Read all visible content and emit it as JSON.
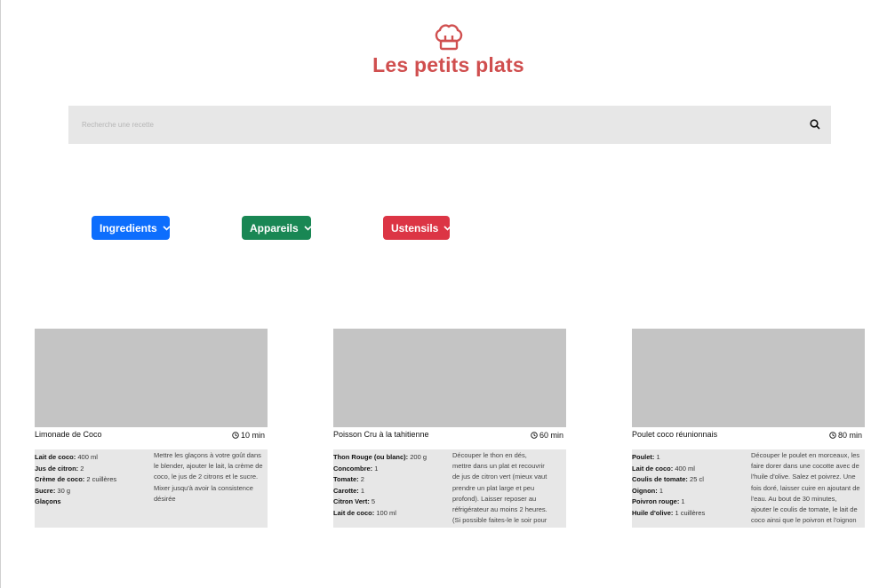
{
  "brand": {
    "name": "Les petits plats",
    "accent": "#D04F4F"
  },
  "search": {
    "placeholder": "Recherche une recette",
    "icon": "search-icon"
  },
  "filters": [
    {
      "label": "Ingredients",
      "color": "#0D6EFD"
    },
    {
      "label": "Appareils",
      "color": "#198754"
    },
    {
      "label": "Ustensils",
      "color": "#DC3545"
    }
  ],
  "recipes": [
    {
      "title": "Limonade de Coco",
      "time": "10 min",
      "ingredients": [
        {
          "name": "Lait de coco:",
          "qty": " 400 ml"
        },
        {
          "name": "Jus de citron:",
          "qty": " 2"
        },
        {
          "name": "Crème de coco:",
          "qty": " 2 cuillères"
        },
        {
          "name": "Sucre:",
          "qty": " 30 g"
        },
        {
          "name": "Glaçons",
          "qty": ""
        }
      ],
      "description_lines": [
        "Mettre les glaçons à votre goût dans",
        "le blender, ajouter le lait, la crème de",
        "coco, le jus de 2 citrons et le sucre.",
        "Mixer jusqu'à avoir la consistence",
        "désirée"
      ]
    },
    {
      "title": "Poisson Cru à la tahitienne",
      "time": "60 min",
      "ingredients": [
        {
          "name": "Thon Rouge (ou blanc):",
          "qty": " 200 g"
        },
        {
          "name": "Concombre:",
          "qty": " 1"
        },
        {
          "name": "Tomate:",
          "qty": " 2"
        },
        {
          "name": "Carotte:",
          "qty": " 1"
        },
        {
          "name": "Citron Vert:",
          "qty": " 5"
        },
        {
          "name": "Lait de coco:",
          "qty": " 100 ml"
        }
      ],
      "description_lines": [
        "Découper le thon en dés,",
        "mettre dans un plat et recouvrir",
        "de jus de citron vert (mieux vaut",
        "prendre un plat large et peu",
        "profond). Laisser reposer au",
        "réfrigérateur au moins 2 heures.",
        "(Si possible faites-le le soir pour"
      ]
    },
    {
      "title": "Poulet coco réunionnais",
      "time": "80 min",
      "ingredients": [
        {
          "name": "Poulet:",
          "qty": " 1"
        },
        {
          "name": "Lait de coco:",
          "qty": " 400 ml"
        },
        {
          "name": "Coulis de tomate:",
          "qty": " 25 cl"
        },
        {
          "name": "Oignon:",
          "qty": " 1"
        },
        {
          "name": "Poivron rouge:",
          "qty": " 1"
        },
        {
          "name": "Huile d'olive:",
          "qty": " 1 cuillères"
        }
      ],
      "description_lines": [
        "Découper le poulet en morceaux, les",
        "faire dorer dans une cocotte avec de",
        "l'huile d'olive. Salez et poivrez. Une",
        "fois doré, laisser cuire en ajoutant de",
        "l'eau. Au bout de 30 minutes,",
        "ajouter le coulis de tomate, le lait de",
        "coco ainsi que le poivron et l'oignon"
      ]
    }
  ]
}
